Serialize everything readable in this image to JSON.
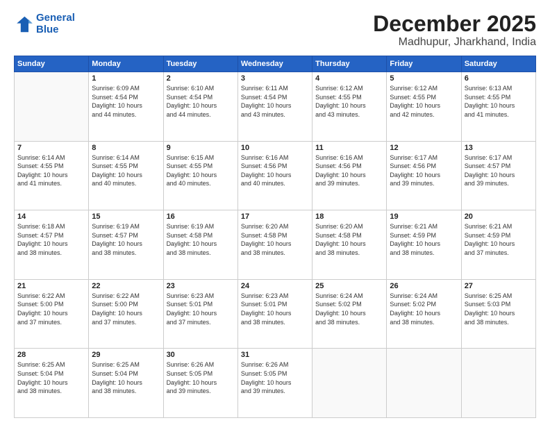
{
  "logo": {
    "line1": "General",
    "line2": "Blue"
  },
  "title": "December 2025",
  "location": "Madhupur, Jharkhand, India",
  "weekdays": [
    "Sunday",
    "Monday",
    "Tuesday",
    "Wednesday",
    "Thursday",
    "Friday",
    "Saturday"
  ],
  "weeks": [
    [
      {
        "day": "",
        "info": ""
      },
      {
        "day": "1",
        "info": "Sunrise: 6:09 AM\nSunset: 4:54 PM\nDaylight: 10 hours\nand 44 minutes."
      },
      {
        "day": "2",
        "info": "Sunrise: 6:10 AM\nSunset: 4:54 PM\nDaylight: 10 hours\nand 44 minutes."
      },
      {
        "day": "3",
        "info": "Sunrise: 6:11 AM\nSunset: 4:54 PM\nDaylight: 10 hours\nand 43 minutes."
      },
      {
        "day": "4",
        "info": "Sunrise: 6:12 AM\nSunset: 4:55 PM\nDaylight: 10 hours\nand 43 minutes."
      },
      {
        "day": "5",
        "info": "Sunrise: 6:12 AM\nSunset: 4:55 PM\nDaylight: 10 hours\nand 42 minutes."
      },
      {
        "day": "6",
        "info": "Sunrise: 6:13 AM\nSunset: 4:55 PM\nDaylight: 10 hours\nand 41 minutes."
      }
    ],
    [
      {
        "day": "7",
        "info": "Sunrise: 6:14 AM\nSunset: 4:55 PM\nDaylight: 10 hours\nand 41 minutes."
      },
      {
        "day": "8",
        "info": "Sunrise: 6:14 AM\nSunset: 4:55 PM\nDaylight: 10 hours\nand 40 minutes."
      },
      {
        "day": "9",
        "info": "Sunrise: 6:15 AM\nSunset: 4:55 PM\nDaylight: 10 hours\nand 40 minutes."
      },
      {
        "day": "10",
        "info": "Sunrise: 6:16 AM\nSunset: 4:56 PM\nDaylight: 10 hours\nand 40 minutes."
      },
      {
        "day": "11",
        "info": "Sunrise: 6:16 AM\nSunset: 4:56 PM\nDaylight: 10 hours\nand 39 minutes."
      },
      {
        "day": "12",
        "info": "Sunrise: 6:17 AM\nSunset: 4:56 PM\nDaylight: 10 hours\nand 39 minutes."
      },
      {
        "day": "13",
        "info": "Sunrise: 6:17 AM\nSunset: 4:57 PM\nDaylight: 10 hours\nand 39 minutes."
      }
    ],
    [
      {
        "day": "14",
        "info": "Sunrise: 6:18 AM\nSunset: 4:57 PM\nDaylight: 10 hours\nand 38 minutes."
      },
      {
        "day": "15",
        "info": "Sunrise: 6:19 AM\nSunset: 4:57 PM\nDaylight: 10 hours\nand 38 minutes."
      },
      {
        "day": "16",
        "info": "Sunrise: 6:19 AM\nSunset: 4:58 PM\nDaylight: 10 hours\nand 38 minutes."
      },
      {
        "day": "17",
        "info": "Sunrise: 6:20 AM\nSunset: 4:58 PM\nDaylight: 10 hours\nand 38 minutes."
      },
      {
        "day": "18",
        "info": "Sunrise: 6:20 AM\nSunset: 4:58 PM\nDaylight: 10 hours\nand 38 minutes."
      },
      {
        "day": "19",
        "info": "Sunrise: 6:21 AM\nSunset: 4:59 PM\nDaylight: 10 hours\nand 38 minutes."
      },
      {
        "day": "20",
        "info": "Sunrise: 6:21 AM\nSunset: 4:59 PM\nDaylight: 10 hours\nand 37 minutes."
      }
    ],
    [
      {
        "day": "21",
        "info": "Sunrise: 6:22 AM\nSunset: 5:00 PM\nDaylight: 10 hours\nand 37 minutes."
      },
      {
        "day": "22",
        "info": "Sunrise: 6:22 AM\nSunset: 5:00 PM\nDaylight: 10 hours\nand 37 minutes."
      },
      {
        "day": "23",
        "info": "Sunrise: 6:23 AM\nSunset: 5:01 PM\nDaylight: 10 hours\nand 37 minutes."
      },
      {
        "day": "24",
        "info": "Sunrise: 6:23 AM\nSunset: 5:01 PM\nDaylight: 10 hours\nand 38 minutes."
      },
      {
        "day": "25",
        "info": "Sunrise: 6:24 AM\nSunset: 5:02 PM\nDaylight: 10 hours\nand 38 minutes."
      },
      {
        "day": "26",
        "info": "Sunrise: 6:24 AM\nSunset: 5:02 PM\nDaylight: 10 hours\nand 38 minutes."
      },
      {
        "day": "27",
        "info": "Sunrise: 6:25 AM\nSunset: 5:03 PM\nDaylight: 10 hours\nand 38 minutes."
      }
    ],
    [
      {
        "day": "28",
        "info": "Sunrise: 6:25 AM\nSunset: 5:04 PM\nDaylight: 10 hours\nand 38 minutes."
      },
      {
        "day": "29",
        "info": "Sunrise: 6:25 AM\nSunset: 5:04 PM\nDaylight: 10 hours\nand 38 minutes."
      },
      {
        "day": "30",
        "info": "Sunrise: 6:26 AM\nSunset: 5:05 PM\nDaylight: 10 hours\nand 39 minutes."
      },
      {
        "day": "31",
        "info": "Sunrise: 6:26 AM\nSunset: 5:05 PM\nDaylight: 10 hours\nand 39 minutes."
      },
      {
        "day": "",
        "info": ""
      },
      {
        "day": "",
        "info": ""
      },
      {
        "day": "",
        "info": ""
      }
    ]
  ]
}
